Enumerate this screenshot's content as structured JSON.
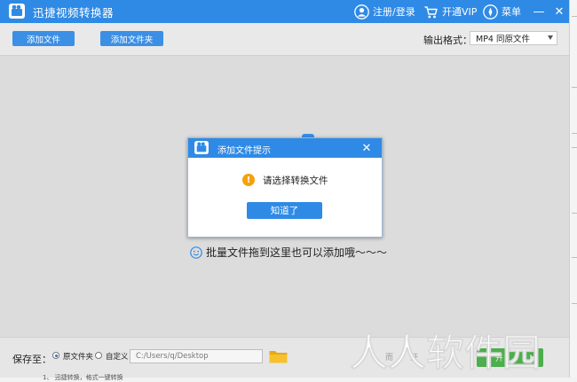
{
  "app": {
    "title": "迅捷视频转换器",
    "login_label": "注册/登录",
    "vip_label": "开通VIP",
    "menu_label": "菜单",
    "minimize_symbol": "—",
    "close_symbol": "✕"
  },
  "toolbar": {
    "add_file_label": "添加文件",
    "add_folder_label": "添加文件夹",
    "format_label": "输出格式：",
    "format_value": "MP4  同原文件"
  },
  "main": {
    "drop_hint": "批量文件拖到这里也可以添加哦～～～",
    "hint_icon": "smiley-icon"
  },
  "dialog": {
    "title": "添加文件提示",
    "message": "请选择转换文件",
    "ok_label": "知道了",
    "close_symbol": "✕"
  },
  "bottom": {
    "save_to_label": "保存至：",
    "option_original": "原文件夹",
    "option_custom": "自定义",
    "selected_option": "original",
    "path_value": "C:/Users/q/Desktop",
    "folder_icon": "folder-icon"
  },
  "watermark": {
    "text": "人人软件园"
  },
  "colors": {
    "accent": "#2f8ae6",
    "title_bar": "#2f8ae6",
    "background": "#dcdcdc",
    "warning": "#f4a20b",
    "start_button": "#4cae4c"
  }
}
